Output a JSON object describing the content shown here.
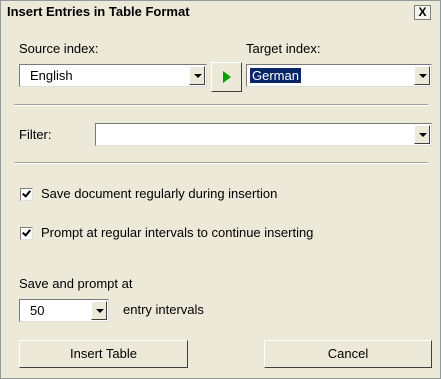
{
  "window": {
    "title": "Insert Entries in Table Format",
    "close_label": "X"
  },
  "source": {
    "label": "Source index:",
    "value": "English"
  },
  "target": {
    "label": "Target index:",
    "value": "German"
  },
  "filter": {
    "label": "Filter:",
    "value": ""
  },
  "options": {
    "save_regularly": {
      "label": "Save document regularly during insertion",
      "checked": true
    },
    "prompt_regularly": {
      "label": "Prompt at regular intervals to continue inserting",
      "checked": true
    }
  },
  "interval": {
    "label": "Save and prompt at",
    "value": "50",
    "suffix": "entry intervals"
  },
  "buttons": {
    "insert": "Insert Table",
    "cancel": "Cancel"
  },
  "colors": {
    "face": "#ece9d8",
    "selection": "#0a246a",
    "play_arrow": "#00a000"
  }
}
